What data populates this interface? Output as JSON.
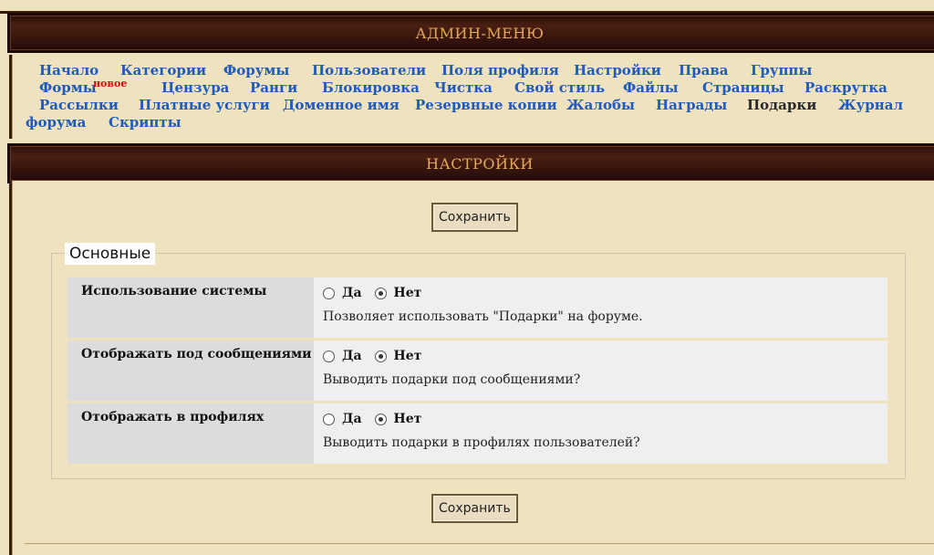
{
  "admin_menu": {
    "title": "АДМИН-МЕНЮ",
    "items": [
      {
        "label": "Начало"
      },
      {
        "label": "Категории"
      },
      {
        "label": "Форумы"
      },
      {
        "label": "Пользователи"
      },
      {
        "label": "Поля профиля"
      },
      {
        "label": "Настройки"
      },
      {
        "label": "Права"
      },
      {
        "label": "Группы"
      },
      {
        "label": "Формы",
        "badge": "новое"
      },
      {
        "label": "Цензура"
      },
      {
        "label": "Ранги"
      },
      {
        "label": "Блокировка"
      },
      {
        "label": "Чистка"
      },
      {
        "label": "Свой стиль"
      },
      {
        "label": "Файлы"
      },
      {
        "label": "Страницы"
      },
      {
        "label": "Раскрутка"
      },
      {
        "label": "Рассылки"
      },
      {
        "label": "Платные услуги"
      },
      {
        "label": "Доменное имя"
      },
      {
        "label": "Резервные копии"
      },
      {
        "label": "Жалобы"
      },
      {
        "label": "Награды"
      },
      {
        "label": "Подарки",
        "active": true
      },
      {
        "label": "Журнал"
      },
      {
        "label": "форума"
      },
      {
        "label": "Скрипты"
      }
    ]
  },
  "settings": {
    "title": "НАСТРОЙКИ",
    "save_label": "Сохранить",
    "section_title": "Основные",
    "rows": [
      {
        "label": "Использование системы",
        "yes": "Да",
        "no": "Нет",
        "value": "no",
        "description": "Позволяет использовать \"Подарки\" на форуме."
      },
      {
        "label": "Отображать под сообщениями",
        "yes": "Да",
        "no": "Нет",
        "value": "no",
        "description": "Выводить подарки под сообщениями?"
      },
      {
        "label": "Отображать в профилях",
        "yes": "Да",
        "no": "Нет",
        "value": "no",
        "description": "Выводить подарки в профилях пользователей?"
      }
    ]
  },
  "colors": {
    "link": "#1f5bbf",
    "active_link": "#2a2a2a",
    "badge": "#d01010",
    "bar_text": "#e3a85a",
    "background": "#efe2bf"
  }
}
